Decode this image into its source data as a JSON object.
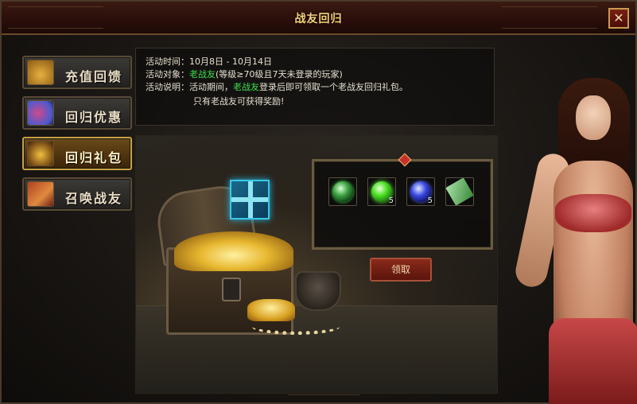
{
  "window": {
    "title": "战友回归",
    "close_label": "✕"
  },
  "nav": {
    "items": [
      {
        "label": "充值回馈",
        "icon": "money-bag-icon",
        "active": false
      },
      {
        "label": "回归优惠",
        "icon": "gifts-icon",
        "active": false
      },
      {
        "label": "回归礼包",
        "icon": "treasure-chest-icon",
        "active": true
      },
      {
        "label": "召唤战友",
        "icon": "scroll-icon",
        "active": false
      }
    ]
  },
  "info": {
    "time_label": "活动时间：",
    "time_value": "10月8日 - 10月14日",
    "target_label": "活动对象：",
    "target_highlight": "老战友",
    "target_rest": "(等级≥70级且7天未登录的玩家)",
    "desc_label": "活动说明：",
    "desc_prefix": "活动期间，",
    "desc_highlight": "老战友",
    "desc_rest": "登录后即可领取一个老战友回归礼包。",
    "note": "只有老战友可获得奖励!"
  },
  "rewards": {
    "items": [
      {
        "icon": "green-orb-icon",
        "qty": ""
      },
      {
        "icon": "green-flame-orb-icon",
        "qty": "5"
      },
      {
        "icon": "blue-orb-icon",
        "qty": "5"
      },
      {
        "icon": "green-ticket-icon",
        "qty": ""
      }
    ],
    "claim_label": "领取"
  },
  "colors": {
    "title_gold": "#f5d27a",
    "highlight_green": "#3ee04a",
    "active_tab_border": "#c8a040"
  }
}
